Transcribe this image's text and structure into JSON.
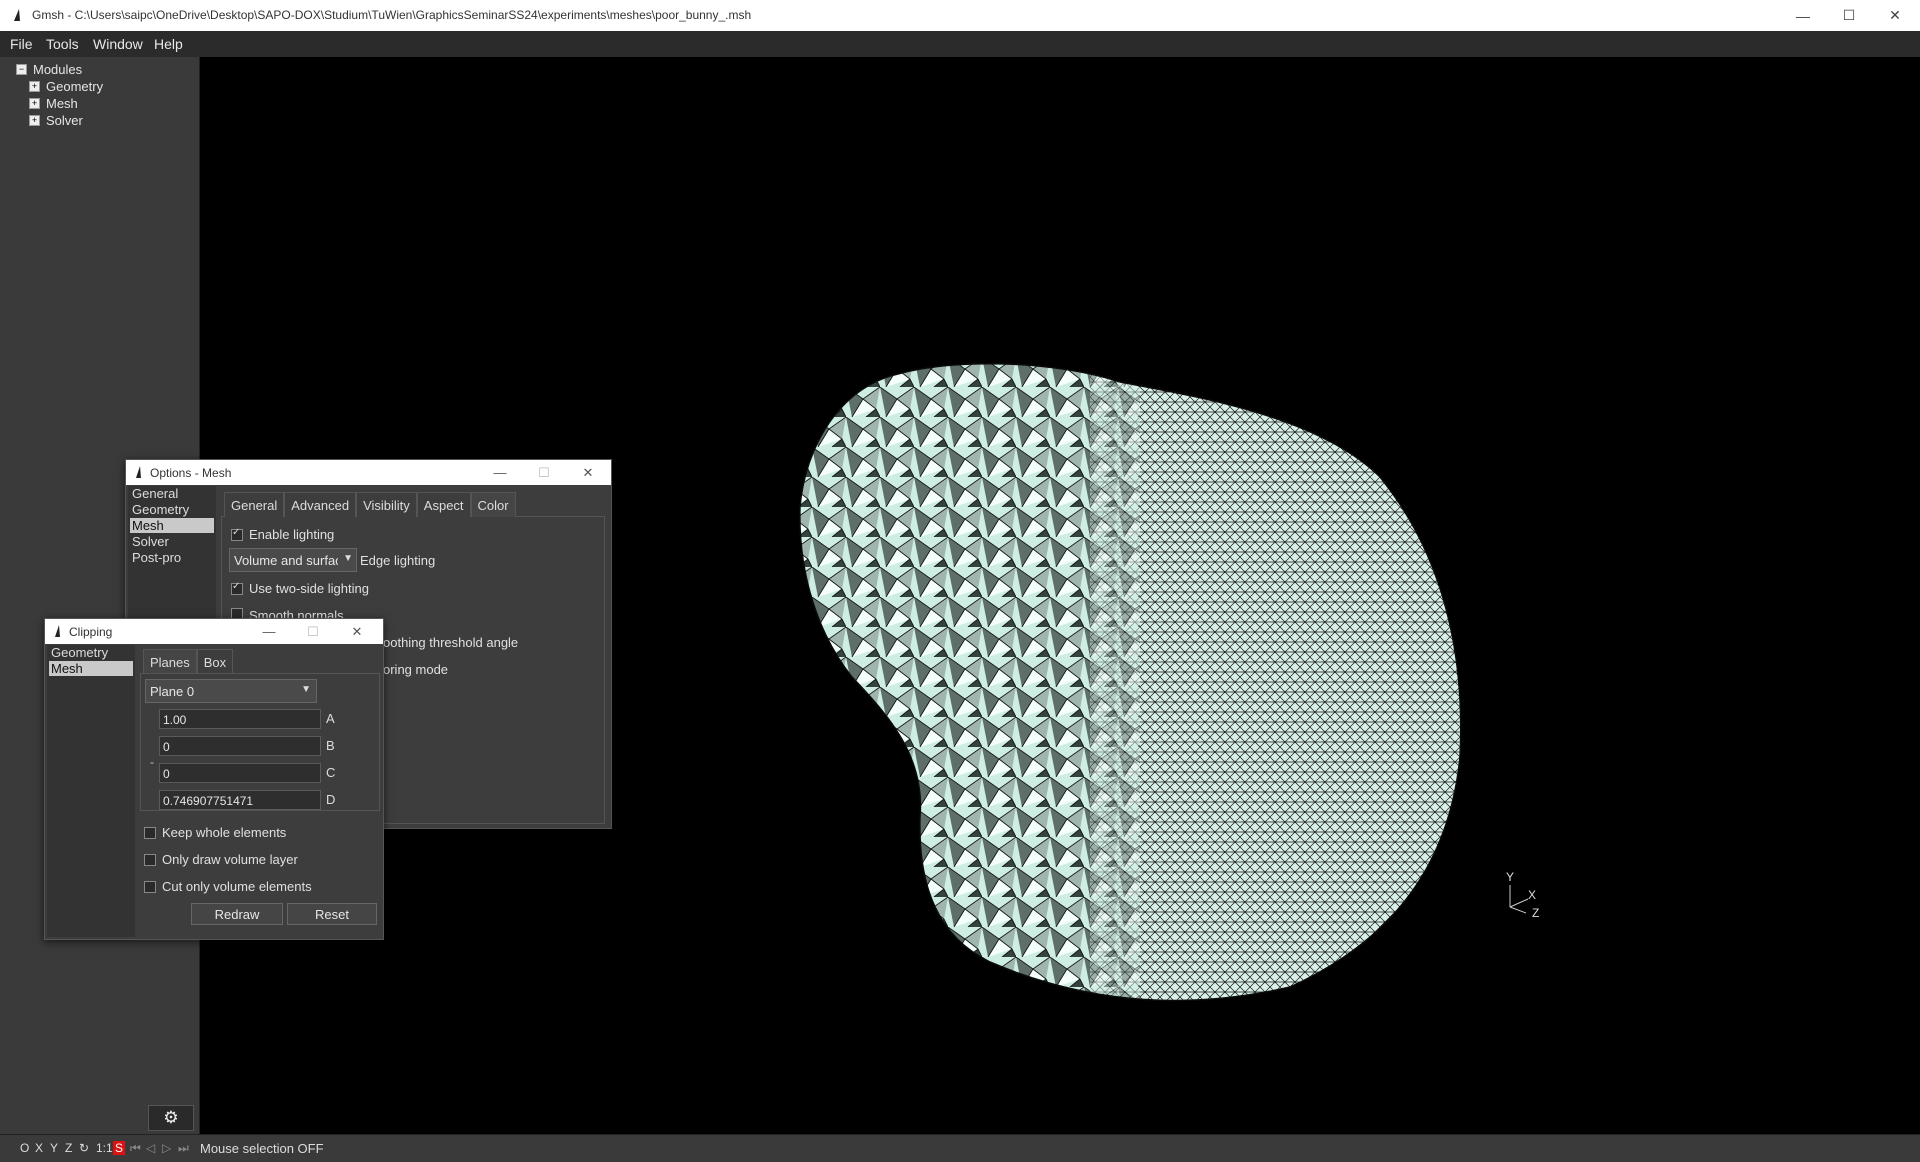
{
  "window": {
    "title": "Gmsh - C:\\Users\\saipc\\OneDrive\\Desktop\\SAPO-DOX\\Studium\\TuWien\\GraphicsSeminarSS24\\experiments\\meshes\\poor_bunny_.msh"
  },
  "menu": [
    "File",
    "Tools",
    "Window",
    "Help"
  ],
  "tree": {
    "root": "Modules",
    "children": [
      "Geometry",
      "Mesh",
      "Solver"
    ]
  },
  "status": {
    "buttons": [
      "O",
      "X",
      "Y",
      "Z",
      "1:1",
      "S"
    ],
    "message": "Mouse selection OFF"
  },
  "axes": {
    "x": "X",
    "y": "Y",
    "z": "Z"
  },
  "options_dialog": {
    "title": "Options - Mesh",
    "nav": [
      "General",
      "Geometry",
      "Mesh",
      "Solver",
      "Post-pro"
    ],
    "selected_nav": "Mesh",
    "tabs": [
      "General",
      "Advanced",
      "Visibility",
      "Aspect",
      "Color"
    ],
    "enable_lighting": "Enable lighting",
    "lighting_mode_value": "Volume and surfac",
    "edge_lighting": "Edge lighting",
    "two_side_lighting": "Use two-side lighting",
    "smooth_normals": "Smooth normals",
    "smoothing_threshold": "oothing threshold angle",
    "coloring_mode": "oring mode"
  },
  "clipping_dialog": {
    "title": "Clipping",
    "nav": [
      "Geometry",
      "Mesh"
    ],
    "selected_nav": "Mesh",
    "tabs": [
      "Planes",
      "Box"
    ],
    "plane_value": "Plane 0",
    "fields": [
      {
        "value": "1.00",
        "label": "A"
      },
      {
        "value": "0",
        "label": "B"
      },
      {
        "value": "0",
        "label": "C"
      },
      {
        "value": "0.746907751471",
        "label": "D"
      }
    ],
    "minus": "-",
    "keep_whole": "Keep whole elements",
    "only_volume": "Only draw volume layer",
    "cut_only_volume": "Cut only volume elements",
    "redraw": "Redraw",
    "reset": "Reset"
  },
  "colors": {
    "mesh_fill": "#cfeee3",
    "mesh_dark": "#3b4a44",
    "mesh_edge": "#111111"
  }
}
